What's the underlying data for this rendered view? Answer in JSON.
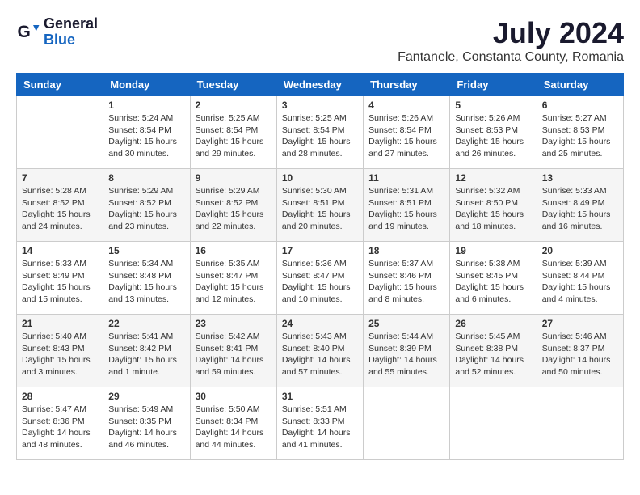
{
  "logo": {
    "general": "General",
    "blue": "Blue"
  },
  "title": "July 2024",
  "location": "Fantanele, Constanta County, Romania",
  "weekdays": [
    "Sunday",
    "Monday",
    "Tuesday",
    "Wednesday",
    "Thursday",
    "Friday",
    "Saturday"
  ],
  "weeks": [
    [
      {
        "day": "",
        "info": ""
      },
      {
        "day": "1",
        "info": "Sunrise: 5:24 AM\nSunset: 8:54 PM\nDaylight: 15 hours\nand 30 minutes."
      },
      {
        "day": "2",
        "info": "Sunrise: 5:25 AM\nSunset: 8:54 PM\nDaylight: 15 hours\nand 29 minutes."
      },
      {
        "day": "3",
        "info": "Sunrise: 5:25 AM\nSunset: 8:54 PM\nDaylight: 15 hours\nand 28 minutes."
      },
      {
        "day": "4",
        "info": "Sunrise: 5:26 AM\nSunset: 8:54 PM\nDaylight: 15 hours\nand 27 minutes."
      },
      {
        "day": "5",
        "info": "Sunrise: 5:26 AM\nSunset: 8:53 PM\nDaylight: 15 hours\nand 26 minutes."
      },
      {
        "day": "6",
        "info": "Sunrise: 5:27 AM\nSunset: 8:53 PM\nDaylight: 15 hours\nand 25 minutes."
      }
    ],
    [
      {
        "day": "7",
        "info": "Sunrise: 5:28 AM\nSunset: 8:52 PM\nDaylight: 15 hours\nand 24 minutes."
      },
      {
        "day": "8",
        "info": "Sunrise: 5:29 AM\nSunset: 8:52 PM\nDaylight: 15 hours\nand 23 minutes."
      },
      {
        "day": "9",
        "info": "Sunrise: 5:29 AM\nSunset: 8:52 PM\nDaylight: 15 hours\nand 22 minutes."
      },
      {
        "day": "10",
        "info": "Sunrise: 5:30 AM\nSunset: 8:51 PM\nDaylight: 15 hours\nand 20 minutes."
      },
      {
        "day": "11",
        "info": "Sunrise: 5:31 AM\nSunset: 8:51 PM\nDaylight: 15 hours\nand 19 minutes."
      },
      {
        "day": "12",
        "info": "Sunrise: 5:32 AM\nSunset: 8:50 PM\nDaylight: 15 hours\nand 18 minutes."
      },
      {
        "day": "13",
        "info": "Sunrise: 5:33 AM\nSunset: 8:49 PM\nDaylight: 15 hours\nand 16 minutes."
      }
    ],
    [
      {
        "day": "14",
        "info": "Sunrise: 5:33 AM\nSunset: 8:49 PM\nDaylight: 15 hours\nand 15 minutes."
      },
      {
        "day": "15",
        "info": "Sunrise: 5:34 AM\nSunset: 8:48 PM\nDaylight: 15 hours\nand 13 minutes."
      },
      {
        "day": "16",
        "info": "Sunrise: 5:35 AM\nSunset: 8:47 PM\nDaylight: 15 hours\nand 12 minutes."
      },
      {
        "day": "17",
        "info": "Sunrise: 5:36 AM\nSunset: 8:47 PM\nDaylight: 15 hours\nand 10 minutes."
      },
      {
        "day": "18",
        "info": "Sunrise: 5:37 AM\nSunset: 8:46 PM\nDaylight: 15 hours\nand 8 minutes."
      },
      {
        "day": "19",
        "info": "Sunrise: 5:38 AM\nSunset: 8:45 PM\nDaylight: 15 hours\nand 6 minutes."
      },
      {
        "day": "20",
        "info": "Sunrise: 5:39 AM\nSunset: 8:44 PM\nDaylight: 15 hours\nand 4 minutes."
      }
    ],
    [
      {
        "day": "21",
        "info": "Sunrise: 5:40 AM\nSunset: 8:43 PM\nDaylight: 15 hours\nand 3 minutes."
      },
      {
        "day": "22",
        "info": "Sunrise: 5:41 AM\nSunset: 8:42 PM\nDaylight: 15 hours\nand 1 minute."
      },
      {
        "day": "23",
        "info": "Sunrise: 5:42 AM\nSunset: 8:41 PM\nDaylight: 14 hours\nand 59 minutes."
      },
      {
        "day": "24",
        "info": "Sunrise: 5:43 AM\nSunset: 8:40 PM\nDaylight: 14 hours\nand 57 minutes."
      },
      {
        "day": "25",
        "info": "Sunrise: 5:44 AM\nSunset: 8:39 PM\nDaylight: 14 hours\nand 55 minutes."
      },
      {
        "day": "26",
        "info": "Sunrise: 5:45 AM\nSunset: 8:38 PM\nDaylight: 14 hours\nand 52 minutes."
      },
      {
        "day": "27",
        "info": "Sunrise: 5:46 AM\nSunset: 8:37 PM\nDaylight: 14 hours\nand 50 minutes."
      }
    ],
    [
      {
        "day": "28",
        "info": "Sunrise: 5:47 AM\nSunset: 8:36 PM\nDaylight: 14 hours\nand 48 minutes."
      },
      {
        "day": "29",
        "info": "Sunrise: 5:49 AM\nSunset: 8:35 PM\nDaylight: 14 hours\nand 46 minutes."
      },
      {
        "day": "30",
        "info": "Sunrise: 5:50 AM\nSunset: 8:34 PM\nDaylight: 14 hours\nand 44 minutes."
      },
      {
        "day": "31",
        "info": "Sunrise: 5:51 AM\nSunset: 8:33 PM\nDaylight: 14 hours\nand 41 minutes."
      },
      {
        "day": "",
        "info": ""
      },
      {
        "day": "",
        "info": ""
      },
      {
        "day": "",
        "info": ""
      }
    ]
  ]
}
